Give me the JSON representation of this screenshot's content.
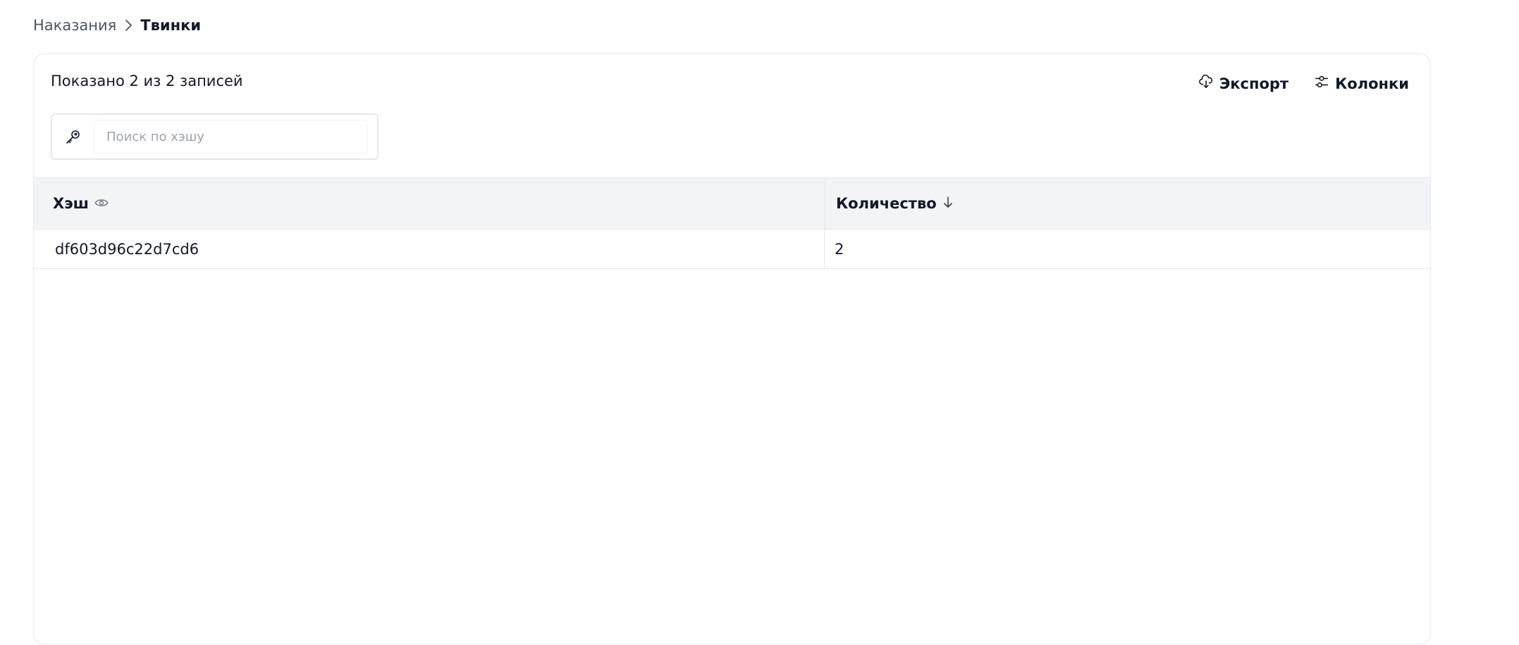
{
  "breadcrumb": {
    "parent": "Наказания",
    "current": "Твинки"
  },
  "toolbar": {
    "shown_text": "Показано 2 из 2 записей",
    "export_label": "Экспорт",
    "columns_label": "Колонки"
  },
  "search": {
    "placeholder": "Поиск по хэшу",
    "value": ""
  },
  "table": {
    "columns": [
      "Хэш",
      "Количество"
    ],
    "rows": [
      {
        "hash": "df603d96c22d7cd6",
        "count": "2"
      }
    ]
  },
  "icons": {
    "breadcrumb_separator": "chevron-right-icon",
    "export": "cloud-download-icon",
    "columns": "sliders-icon",
    "search": "key-icon",
    "hash_column": "eye-icon",
    "sort": "arrow-down-icon"
  }
}
